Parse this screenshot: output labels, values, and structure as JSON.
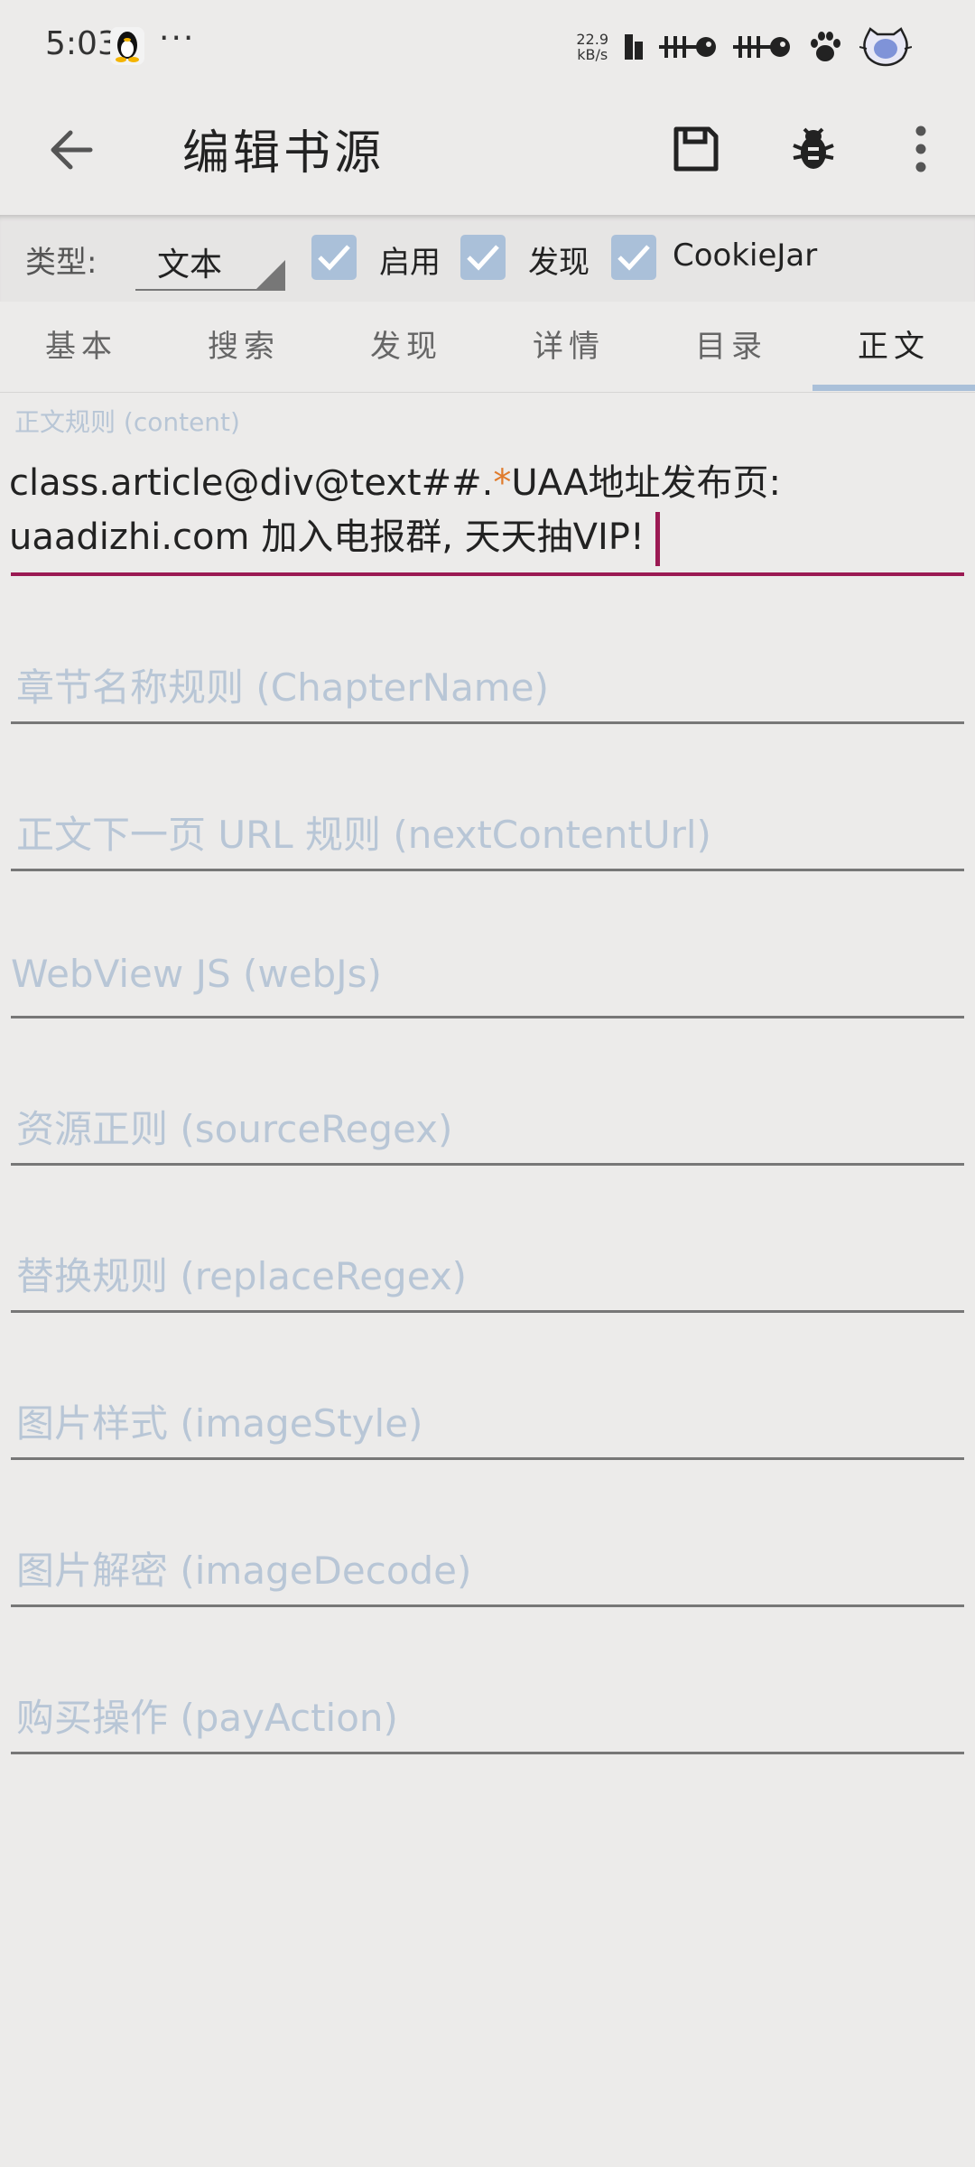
{
  "status_bar": {
    "time": "5:03",
    "more": "···",
    "net_speed_value": "22.9",
    "net_speed_unit": "kB/s"
  },
  "app_bar": {
    "title": "编辑书源"
  },
  "type_row": {
    "type_label": "类型:",
    "type_value": "文本",
    "checkboxes": [
      {
        "label": "启用",
        "checked": true
      },
      {
        "label": "发现",
        "checked": true
      },
      {
        "label": "CookieJar",
        "checked": true
      }
    ]
  },
  "tabs": [
    {
      "label": "基本"
    },
    {
      "label": "搜索"
    },
    {
      "label": "发现"
    },
    {
      "label": "详情"
    },
    {
      "label": "目录"
    },
    {
      "label": "正文",
      "active": true
    }
  ],
  "content_field": {
    "label": "正文规则 (content)",
    "value_part1": "class.article@div@text##.",
    "value_highlight": "*",
    "value_part2": "UAA地址发布页:",
    "value_line2": "uaadizhi.com 加入电报群, 天天抽VIP!"
  },
  "fields": [
    {
      "placeholder": "章节名称规则 (ChapterName)"
    },
    {
      "placeholder": "正文下一页 URL 规则 (nextContentUrl)"
    },
    {
      "placeholder": "WebView JS (webJs)"
    },
    {
      "placeholder": "资源正则 (sourceRegex)"
    },
    {
      "placeholder": "替换规则 (replaceRegex)"
    },
    {
      "placeholder": "图片样式 (imageStyle)"
    },
    {
      "placeholder": "图片解密 (imageDecode)"
    },
    {
      "placeholder": "购买操作 (payAction)"
    }
  ],
  "colors": {
    "background": "#ecebea",
    "accent": "#9b1a53",
    "checkbox": "#aac0d9",
    "placeholder": "#b8c6d6"
  }
}
